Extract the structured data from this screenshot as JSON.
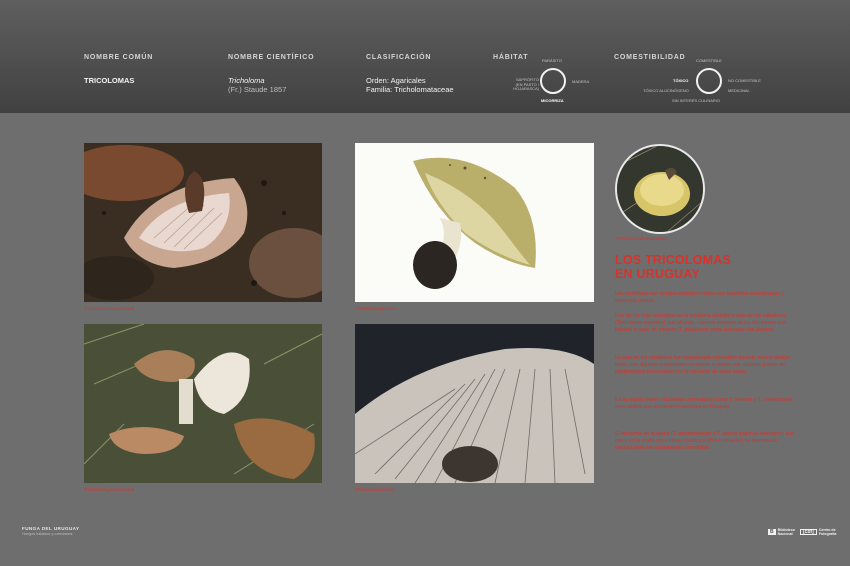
{
  "header": {
    "labels": {
      "common": "NOMBRE COMÚN",
      "scientific": "NOMBRE CIENTÍFICO",
      "classification": "CLASIFICACIÓN",
      "habitat": "HÁBITAT",
      "edibility": "COMESTIBILIDAD"
    },
    "common_name": "TRICOLOMAS",
    "scientific_name": "Tricholoma",
    "scientific_author": "(Fr.) Staude 1857",
    "order": "Orden: Agaricales",
    "family": "Familia: Tricholomataceae",
    "habitat_dial": {
      "top": "PARÁSITO",
      "left": "SAPRÓFITO (EN PASTO / HOJARASCA)",
      "right": "MADERA",
      "bottom": "MICORRIZA",
      "selected": "MICORRIZA"
    },
    "edibility_dial": {
      "top": "COMESTIBLE",
      "left": "TÓXICO",
      "right": "NO COMESTIBLE",
      "bottom_left": "TÓXICO ALUCINÓGENO",
      "bottom_right": "MEDICINAL",
      "bottom": "SIN INTERÉS CULINARIO",
      "selected": "TÓXICO"
    }
  },
  "photos": {
    "p1_caption": "Tricholoma pessundatum",
    "p2_caption": "Tricholoma equestre",
    "p3_caption": "Tricholoma pessundatum",
    "p4_caption": "Tricholoma terreum",
    "circle_caption": "Tricholoma albobrunneum"
  },
  "side": {
    "title_line1": "LOS TRICOLOMAS",
    "title_line2": "EN URUGUAY",
    "paragraphs": [
      "Los tricolomas son hongos ectomicorrícicos con laminillas emarginadas y esporada blanca.",
      "Uno de los más conocidos es el tricoloma amarillo o seta de los caballeros (Tricholoma equestre) que abunda, como la mayoría de los tricolomas que habitan el país, en pinares (T. populinum crece asociado con álamos).",
      "La seta de los caballeros fue considerada comestible durante mucho tiempo hasta que algunos recolectores europeos murieron por cuadros graves de rabdomiólisis provocados por el consumo de estas setas.",
      "En la región crecen tricolomas comestibles como T. terreum y T. portentosum, pero ambos son sumamente escasos en Uruguay.",
      "El tricoloma de la arena (T. albobrunneum o T. stanzii según el descriptor) que crece en la costa entre pinos marítimos (Pinus pinaster) es demasiado amargo para ser considerado comestible."
    ]
  },
  "footer": {
    "title": "FUNGA DEL URUGUAY",
    "subtitle": "Hongos hallados y colectados",
    "logo1_mark": "B",
    "logo1_text": "Biblioteca Nacional",
    "logo2_mark": "[cdf]",
    "logo2_text": "Centro de Fotografía"
  },
  "colors": {
    "accent": "#d9322b",
    "background": "#6e6e6e",
    "header": "#4a4a4a"
  }
}
